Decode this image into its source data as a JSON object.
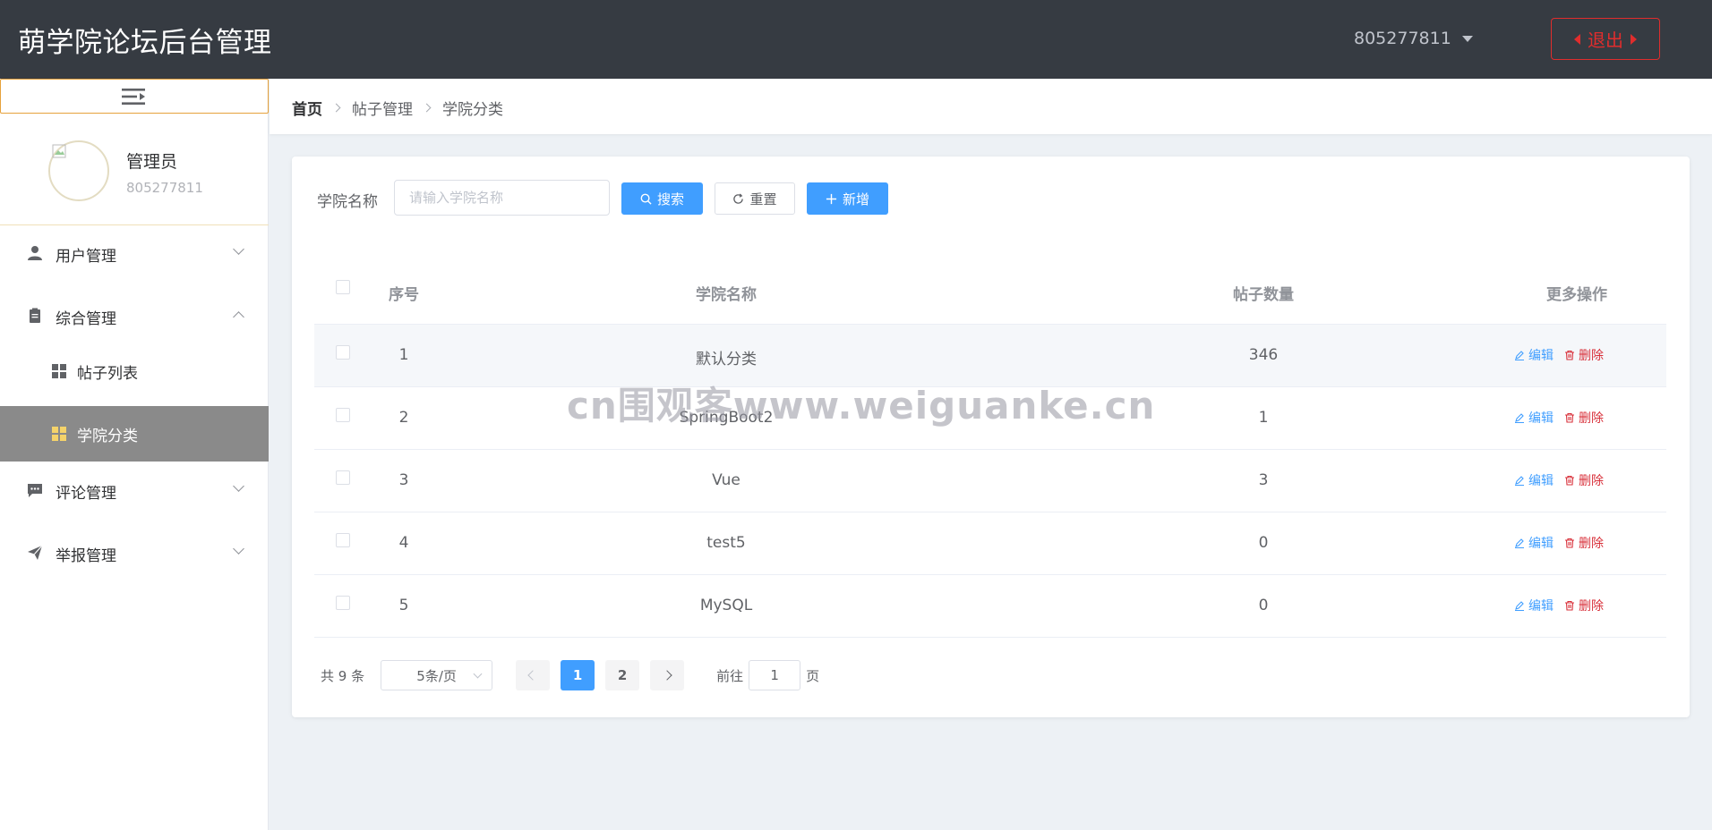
{
  "header": {
    "title": "萌学院论坛后台管理",
    "username": "805277811",
    "logout_label": "退出"
  },
  "sidebar": {
    "profile": {
      "role": "管理员",
      "id": "805277811"
    },
    "menu": {
      "user_mgmt": "用户管理",
      "general_mgmt": "综合管理",
      "post_list": "帖子列表",
      "college_category": "学院分类",
      "comment_mgmt": "评论管理",
      "report_mgmt": "举报管理"
    }
  },
  "breadcrumb": [
    "首页",
    "帖子管理",
    "学院分类"
  ],
  "search": {
    "label": "学院名称",
    "placeholder": "请输入学院名称",
    "value": "",
    "search_label": "搜索",
    "reset_label": "重置",
    "add_label": "新增"
  },
  "table": {
    "headers": {
      "index": "序号",
      "name": "学院名称",
      "count": "帖子数量",
      "ops": "更多操作"
    },
    "rows": [
      {
        "index": "1",
        "name": "默认分类",
        "count": "346"
      },
      {
        "index": "2",
        "name": "SpringBoot2",
        "count": "1"
      },
      {
        "index": "3",
        "name": "Vue",
        "count": "3"
      },
      {
        "index": "4",
        "name": "test5",
        "count": "0"
      },
      {
        "index": "5",
        "name": "MySQL",
        "count": "0"
      }
    ],
    "edit_label": "编辑",
    "delete_label": "删除"
  },
  "pagination": {
    "total": "共 9 条",
    "page_size": "5条/页",
    "pages": [
      "1",
      "2"
    ],
    "goto_prefix": "前往",
    "goto_value": "1",
    "goto_suffix": "页"
  },
  "watermark": "cn围观客www.weiguanke.cn",
  "colors": {
    "header_bg": "#363b42",
    "primary": "#409eff",
    "danger": "#d8303a",
    "active_menu": "#8a8a8a"
  }
}
